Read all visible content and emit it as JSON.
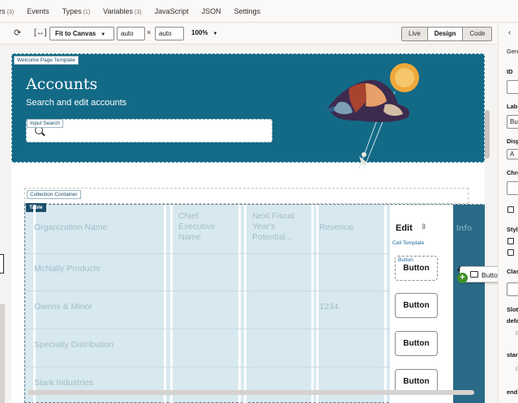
{
  "tabs": [
    {
      "label": "rs",
      "count": "(3)"
    },
    {
      "label": "Events",
      "count": ""
    },
    {
      "label": "Types",
      "count": "(1)"
    },
    {
      "label": "Variables",
      "count": "(3)"
    },
    {
      "label": "JavaScript",
      "count": ""
    },
    {
      "label": "JSON",
      "count": ""
    },
    {
      "label": "Settings",
      "count": ""
    }
  ],
  "toolbar": {
    "fit_select": "Fit to Canvas",
    "width_value": "auto",
    "times": "×",
    "height_value": "auto",
    "zoom": "100%",
    "modes": [
      "Live",
      "Design",
      "Code"
    ],
    "active_mode": "Design"
  },
  "hero": {
    "template_chip": "Welcome Page Template",
    "title": "Accounts",
    "subtitle": "Search and edit accounts",
    "input_chip": "Input Search"
  },
  "collection_chip": "Collection Container",
  "table": {
    "chip": "Table",
    "headers": [
      "Organization Name",
      "Chief Executive Name",
      "Next Fiscal Year's Potential...",
      "Revenue"
    ],
    "rows": [
      {
        "org": "McNally Products",
        "revenue": ""
      },
      {
        "org": "Owens & Minor",
        "revenue": "1234"
      },
      {
        "org": "Specialty Distribution",
        "revenue": ""
      },
      {
        "org": "Stark Industries",
        "revenue": ""
      }
    ],
    "edit_header": "Edit",
    "cell_template_chip": "Cell Template",
    "button_chip": "Button",
    "button_label": "Button",
    "info_header": "Info"
  },
  "drag": {
    "label": "Button",
    "badge": "+"
  },
  "panel": {
    "section": "Gen",
    "id_label": "ID",
    "label_label": "Lab",
    "label_value": "Bu",
    "display_label": "Disp",
    "display_value": "A",
    "chroming_label": "Chro",
    "style_label": "Styl",
    "class_label": "Clas",
    "slot_label": "Slot",
    "default_label": "defa",
    "start_label": "star",
    "end_label": "end",
    "hint": "E"
  },
  "colors": {
    "hero_bg": "#136a86",
    "table_bg": "#d8e8ef",
    "info_bg": "#2a6a86",
    "add_badge": "#3f8f2a"
  }
}
